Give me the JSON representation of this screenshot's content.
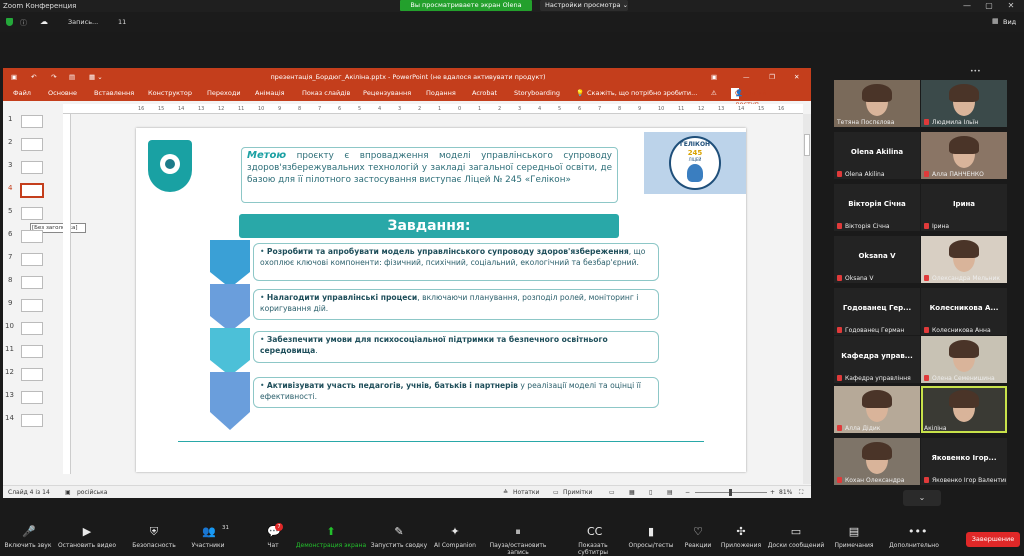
{
  "zoom": {
    "app_title": "Zoom Конференция",
    "share_banner": "Вы просматриваете экран Olena Akilina",
    "view_settings": "Настройки просмотра",
    "recording": "Запись...",
    "recording_time": "11",
    "view_label": "Вид",
    "expand_icon": "more-horizontal-icon"
  },
  "ppt": {
    "title": "презентація_Бордюг_Акіліна.pptx - PowerPoint (не вдалося активувати продукт)",
    "tabs": [
      "Файл",
      "Основне",
      "Вставлення",
      "Конструктор",
      "Переходи",
      "Анімація",
      "Показ слайдів",
      "Рецензування",
      "Подання",
      "Acrobat",
      "Storyboarding"
    ],
    "tell_me": "Скажіть, що потрібно зробити...",
    "share": "Спільний доступ",
    "thumb_numbers": [
      "1",
      "2",
      "3",
      "4",
      "5",
      "6",
      "7",
      "8",
      "9",
      "10",
      "11",
      "12",
      "13",
      "14"
    ],
    "tooltip": "[Без заголовка]",
    "status_slide": "Слайд 4 із 14",
    "status_lang": "російська",
    "notes": "Нотатки",
    "comments": "Примітки",
    "zoom": "81%",
    "ruler_marks": [
      "16",
      "15",
      "14",
      "13",
      "12",
      "11",
      "10",
      "9",
      "8",
      "7",
      "6",
      "5",
      "4",
      "3",
      "2",
      "1",
      "0",
      "1",
      "2",
      "3",
      "4",
      "5",
      "6",
      "7",
      "8",
      "9",
      "10",
      "11",
      "12",
      "13",
      "14",
      "15",
      "16"
    ]
  },
  "slide": {
    "goal_word": "Метою",
    "goal_text": " проєкту є впровадження моделі управлінського супроводу здоров'язбережувальних технологій у закладі загальної середньої освіти, де базою для її пілотного застосування виступає Ліцей № 245 «Гелікон»",
    "tasks_title": "Завдання:",
    "tasks": [
      {
        "bold": "Розробити та апробувати модель управлінського супроводу здоров'язбереження",
        "rest": ", що охоплює ключові компоненти: фізичний, психічний, соціальний, екологічний та безбар'єрний."
      },
      {
        "bold": "Налагодити управлінські процеси",
        "rest": ", включаючи планування, розподіл ролей, моніторинг і коригування дій."
      },
      {
        "bold": "Забезпечити умови для психосоціальної підтримки та безпечного освітнього середовища",
        "rest": "."
      },
      {
        "bold": "Активізувати участь педагогів, учнів, батьків і партнерів",
        "rest": " у реалізації моделі та оцінці її ефективності."
      }
    ],
    "logo_text": "ГЕЛІКОН",
    "logo_num": "245",
    "logo_sub": "ЛІЦЕЙ"
  },
  "participants": [
    {
      "name": "Тетяна Поспєлова",
      "big": "",
      "muted": false,
      "video": true,
      "bg": "#7a6a5a"
    },
    {
      "name": "Людмила Ільїн",
      "big": "",
      "muted": true,
      "video": true,
      "bg": "#3b4a4a"
    },
    {
      "name": "Olena Akilina",
      "big": "Olena Akilina",
      "muted": true,
      "video": false,
      "bg": "#232323"
    },
    {
      "name": "Алла ПАНЧЕНКО",
      "big": "",
      "muted": true,
      "video": true,
      "bg": "#8a7565"
    },
    {
      "name": "Вікторія Січна",
      "big": "Вікторія Січна",
      "muted": true,
      "video": false,
      "bg": "#232323"
    },
    {
      "name": "Ірина",
      "big": "Ірина",
      "muted": true,
      "video": false,
      "bg": "#232323"
    },
    {
      "name": "Oksana V",
      "big": "Oksana V",
      "muted": true,
      "video": false,
      "bg": "#232323"
    },
    {
      "name": "Олександра Мельник",
      "big": "",
      "muted": true,
      "video": true,
      "bg": "#d8cfc3"
    },
    {
      "name": "Годованец Герман",
      "big": "Годованец Гер...",
      "muted": true,
      "video": false,
      "bg": "#232323"
    },
    {
      "name": "Колесникова Анна",
      "big": "Колесникова А...",
      "muted": true,
      "video": false,
      "bg": "#232323"
    },
    {
      "name": "Кафедра управління",
      "big": "Кафедра управ...",
      "muted": true,
      "video": false,
      "bg": "#232323"
    },
    {
      "name": "Олена Семенишина",
      "big": "",
      "muted": true,
      "video": true,
      "bg": "#c8c2b4"
    },
    {
      "name": "Алла Дідик",
      "big": "",
      "muted": true,
      "video": true,
      "bg": "#b6a998"
    },
    {
      "name": "Акіліна",
      "big": "",
      "muted": false,
      "video": true,
      "bg": "#3a3a34"
    },
    {
      "name": "Кохан Олександра",
      "big": "",
      "muted": true,
      "video": true,
      "bg": "#7e7468"
    },
    {
      "name": "Яковенко Ігор Валентинович",
      "big": "Яковенко Ігор...",
      "muted": true,
      "video": false,
      "bg": "#232323"
    }
  ],
  "toolbar": [
    {
      "label": "Включить звук",
      "icon": "mic-off-icon",
      "glyph": "🎤"
    },
    {
      "label": "Остановить видео",
      "icon": "video-icon",
      "glyph": "▶"
    },
    {
      "label": "Безопасность",
      "icon": "shield-icon",
      "glyph": "⛨"
    },
    {
      "label": "Участники",
      "icon": "participants-icon",
      "glyph": "👥"
    },
    {
      "label": "Чат",
      "icon": "chat-icon",
      "glyph": "💬"
    },
    {
      "label": "Демонстрация экрана",
      "icon": "share-screen-icon",
      "glyph": "⬆"
    },
    {
      "label": "Запустить сводку",
      "icon": "summary-icon",
      "glyph": "✎"
    },
    {
      "label": "AI Companion",
      "icon": "ai-companion-icon",
      "glyph": "✦"
    },
    {
      "label": "Пауза/остановить запись",
      "icon": "pause-record-icon",
      "glyph": "⏸"
    },
    {
      "label": "Показать субтитры",
      "icon": "captions-icon",
      "glyph": "CC"
    },
    {
      "label": "Опросы/тесты",
      "icon": "polls-icon",
      "glyph": "▮"
    },
    {
      "label": "Реакции",
      "icon": "reactions-icon",
      "glyph": "♡"
    },
    {
      "label": "Приложения",
      "icon": "apps-icon",
      "glyph": "✣"
    },
    {
      "label": "Доски сообщений",
      "icon": "whiteboards-icon",
      "glyph": "▭"
    },
    {
      "label": "Примечания",
      "icon": "notes-icon",
      "glyph": "▤"
    },
    {
      "label": "Дополнительно",
      "icon": "more-icon",
      "glyph": "•••"
    }
  ],
  "participants_count": "31",
  "chat_badge": "7",
  "end_label": "Завершение",
  "colors": {
    "accent": "#c43e1c",
    "teal": "#2aa6a8",
    "chev1": "#3aa0d6",
    "chev2": "#6a9edc",
    "chev3": "#4cc0d8",
    "chev4": "#6a9edc",
    "zoom_green": "#23a02c",
    "end_red": "#e02828"
  }
}
